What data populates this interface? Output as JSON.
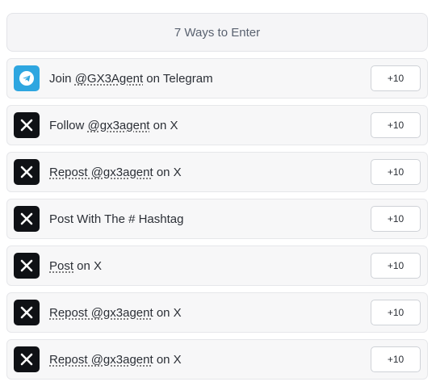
{
  "header": {
    "title": "7 Ways to Enter"
  },
  "entries": [
    {
      "icon": "telegram-icon",
      "pre": "Join ",
      "link": "@GX3Agent",
      "post": " on Telegram",
      "points": "+10"
    },
    {
      "icon": "x-icon",
      "pre": "Follow ",
      "link": "@gx3agent",
      "post": " on X",
      "points": "+10"
    },
    {
      "icon": "x-icon",
      "pre": "",
      "link": "Repost @gx3agent",
      "post": " on X",
      "points": "+10"
    },
    {
      "icon": "x-icon",
      "pre": "Post With The # Hashtag",
      "link": "",
      "post": "",
      "points": "+10"
    },
    {
      "icon": "x-icon",
      "pre": "",
      "link": "Post",
      "post": " on X",
      "points": "+10"
    },
    {
      "icon": "x-icon",
      "pre": "",
      "link": "Repost @gx3agent",
      "post": " on X",
      "points": "+10"
    },
    {
      "icon": "x-icon",
      "pre": "",
      "link": "Repost @gx3agent",
      "post": " on X",
      "points": "+10"
    }
  ],
  "colors": {
    "telegram": "#2ea6e0",
    "x": "#0f1115"
  }
}
